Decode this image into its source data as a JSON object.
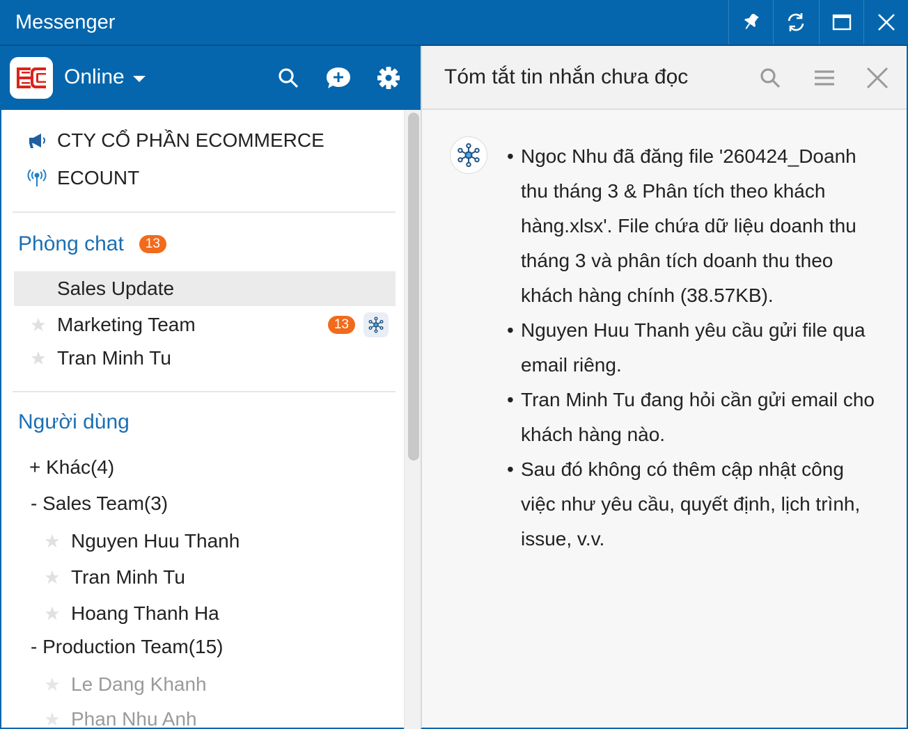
{
  "window": {
    "title": "Messenger",
    "buttons": [
      "pin-icon",
      "refresh-icon",
      "maximize-icon",
      "close-icon"
    ]
  },
  "left": {
    "status": "Online",
    "org": [
      {
        "label": "CTY CỔ PHẦN ECOMMERCE",
        "icon": "megaphone-icon"
      },
      {
        "label": "ECOUNT",
        "icon": "broadcast-icon"
      }
    ],
    "chatrooms": {
      "title": "Phòng chat",
      "badge": "13",
      "items": [
        {
          "label": "Sales Update",
          "selected": true
        },
        {
          "label": "Marketing Team",
          "count": "13",
          "ai": true
        },
        {
          "label": "Tran Minh Tu"
        }
      ]
    },
    "users": {
      "title": "Người dùng",
      "groups": [
        {
          "label": "+ Khác(4)"
        },
        {
          "label": "- Sales Team(3)"
        },
        {
          "label": "- Production Team(15)"
        }
      ],
      "sales_members": [
        "Nguyen Huu Thanh",
        "Tran Minh Tu",
        "Hoang Thanh Ha"
      ],
      "production_members": [
        "Le Dang Khanh",
        "Phan Nhu Anh"
      ]
    }
  },
  "right": {
    "title": "Tóm tắt tin nhắn chưa đọc",
    "summary": [
      "Ngoc Nhu đã đăng file '260424_Doanh thu tháng 3 & Phân tích theo khách hàng.xlsx'. File chứa dữ liệu doanh thu tháng 3 và phân tích doanh thu theo khách hàng chính (38.57KB).",
      "Nguyen Huu Thanh yêu cầu gửi file qua email riêng.",
      "Tran Minh Tu đang hỏi cần gửi email cho khách hàng nào.",
      "Sau đó không có thêm cập nhật công việc như yêu cầu, quyết định, lịch trình, issue, v.v."
    ]
  },
  "colors": {
    "brand": "#0566ad",
    "badge": "#f26a1b",
    "section": "#1a6fb4"
  }
}
